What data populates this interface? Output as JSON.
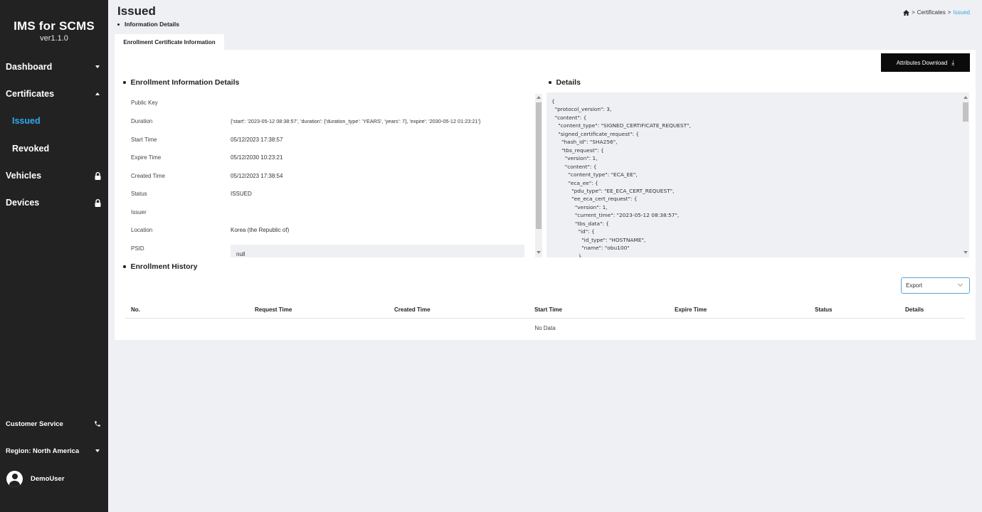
{
  "brand": {
    "title": "IMS for SCMS",
    "version": "ver1.1.0"
  },
  "sidebar": {
    "items": [
      {
        "label": "Dashboard",
        "icon": "chevron-down-icon"
      },
      {
        "label": "Certificates",
        "icon": "chevron-up-icon"
      },
      {
        "label": "Issued"
      },
      {
        "label": "Revoked"
      },
      {
        "label": "Vehicles",
        "icon": "lock-icon"
      },
      {
        "label": "Devices",
        "icon": "lock-icon"
      }
    ],
    "customer_service": "Customer Service",
    "region": "Region: North America",
    "user": "DemoUser"
  },
  "header": {
    "title": "Issued",
    "subtitle": "Information Details",
    "breadcrumb": {
      "home_icon": "home-icon",
      "parent": "Certificates",
      "current": "Issued"
    }
  },
  "tab": {
    "label": "Enrollment Certificate Information"
  },
  "actions": {
    "download_label": "Attributes Download",
    "download_icon": "⤓"
  },
  "info": {
    "title": "Enrollment Information Details",
    "fields": [
      {
        "label": "Public Key",
        "value": ""
      },
      {
        "label": "Duration",
        "value": "{'start': '2023-05-12 08:38:57', 'duration': {'duration_type': 'YEARS', 'years': 7}, 'expire': '2030-05-12 01:23:21'}"
      },
      {
        "label": "Start Time",
        "value": "05/12/2023 17:38:57"
      },
      {
        "label": "Expire Time",
        "value": "05/12/2030 10:23:21"
      },
      {
        "label": "Created Time",
        "value": "05/12/2023 17:38:54"
      },
      {
        "label": "Status",
        "value": "ISSUED"
      },
      {
        "label": "Issuer",
        "value": ""
      },
      {
        "label": "Location",
        "value": "Korea (the Republic of)"
      },
      {
        "label": "PSID",
        "value": "null"
      }
    ]
  },
  "details": {
    "title": "Details",
    "json_text": "{\n  \"protocol_version\": 3,\n  \"content\": {\n    \"content_type\": \"SIGNED_CERTIFICATE_REQUEST\",\n    \"signed_certificate_request\": {\n      \"hash_id\": \"SHA256\",\n      \"tbs_request\": {\n        \"version\": 1,\n        \"content\": {\n          \"content_type\": \"ECA_EE\",\n          \"eca_ee\": {\n            \"pdu_type\": \"EE_ECA_CERT_REQUEST\",\n            \"ee_eca_cert_request\": {\n              \"version\": 1,\n              \"current_time\": \"2023-05-12 08:38:57\",\n              \"tbs_data\": {\n                \"id\": {\n                  \"id_type\": \"HOSTNAME\",\n                  \"name\": \"obu100\"\n                },"
  },
  "history": {
    "title": "Enrollment History",
    "export_label": "Export",
    "columns": [
      "No.",
      "Request Time",
      "Created Time",
      "Start Time",
      "Expire Time",
      "Status",
      "Details"
    ],
    "empty_text": "No Data"
  }
}
